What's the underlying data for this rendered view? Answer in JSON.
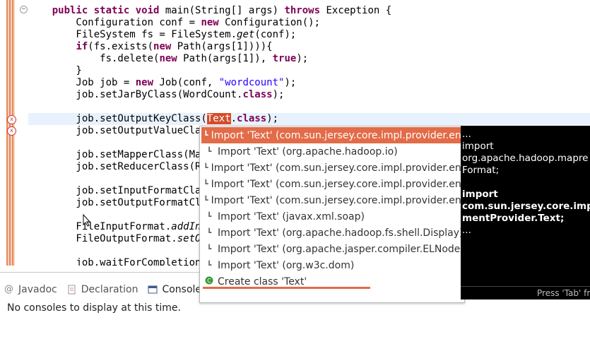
{
  "editor": {
    "lines": [
      {
        "segments": [
          {
            "t": "    ",
            "c": ""
          },
          {
            "t": "public static void",
            "c": "kw"
          },
          {
            "t": " main(String[] args) ",
            "c": ""
          },
          {
            "t": "throws",
            "c": "kw"
          },
          {
            "t": " Exception {",
            "c": ""
          }
        ]
      },
      {
        "segments": [
          {
            "t": "        Configuration conf = ",
            "c": ""
          },
          {
            "t": "new",
            "c": "kw"
          },
          {
            "t": " Configuration();",
            "c": ""
          }
        ]
      },
      {
        "segments": [
          {
            "t": "        FileSystem fs = FileSystem.",
            "c": ""
          },
          {
            "t": "get",
            "c": "it"
          },
          {
            "t": "(conf);",
            "c": ""
          }
        ]
      },
      {
        "segments": [
          {
            "t": "        ",
            "c": ""
          },
          {
            "t": "if",
            "c": "kw"
          },
          {
            "t": "(fs.exists(",
            "c": ""
          },
          {
            "t": "new",
            "c": "kw"
          },
          {
            "t": " Path(args[1]))){",
            "c": ""
          }
        ]
      },
      {
        "segments": [
          {
            "t": "            fs.delete(",
            "c": ""
          },
          {
            "t": "new",
            "c": "kw"
          },
          {
            "t": " Path(args[1]), ",
            "c": ""
          },
          {
            "t": "true",
            "c": "kw"
          },
          {
            "t": ");",
            "c": ""
          }
        ]
      },
      {
        "segments": [
          {
            "t": "        }",
            "c": ""
          }
        ]
      },
      {
        "segments": [
          {
            "t": "        Job job = ",
            "c": ""
          },
          {
            "t": "new",
            "c": "kw"
          },
          {
            "t": " Job(conf, ",
            "c": ""
          },
          {
            "t": "\"wordcount\"",
            "c": "str"
          },
          {
            "t": ");",
            "c": ""
          }
        ]
      },
      {
        "segments": [
          {
            "t": "        job.setJarByClass(WordCount.",
            "c": ""
          },
          {
            "t": "class",
            "c": "kw"
          },
          {
            "t": ");",
            "c": ""
          }
        ]
      },
      {
        "segments": []
      },
      {
        "segments": [
          {
            "t": "        job.setOutputKeyClass(",
            "c": ""
          },
          {
            "t": "Text",
            "c": "hl"
          },
          {
            "t": ".",
            "c": ""
          },
          {
            "t": "class",
            "c": "kw"
          },
          {
            "t": ");",
            "c": ""
          }
        ]
      },
      {
        "segments": [
          {
            "t": "        job.setOutputValueClas",
            "c": ""
          }
        ]
      },
      {
        "segments": []
      },
      {
        "segments": [
          {
            "t": "        job.setMapperClass(Map",
            "c": ""
          }
        ]
      },
      {
        "segments": [
          {
            "t": "        job.setReducerClass(Re",
            "c": ""
          }
        ]
      },
      {
        "segments": []
      },
      {
        "segments": [
          {
            "t": "        job.setInputFormatClas",
            "c": ""
          }
        ]
      },
      {
        "segments": [
          {
            "t": "        job.setOutputFormatCla",
            "c": ""
          }
        ]
      },
      {
        "segments": []
      },
      {
        "segments": [
          {
            "t": "        FileInputFormat.",
            "c": ""
          },
          {
            "t": "addInp",
            "c": "it"
          }
        ]
      },
      {
        "segments": [
          {
            "t": "        FileOutputFormat.",
            "c": ""
          },
          {
            "t": "setOu",
            "c": "it"
          }
        ]
      },
      {
        "segments": []
      },
      {
        "segments": [
          {
            "t": "        job.waitForCompletion(",
            "c": ""
          }
        ]
      }
    ]
  },
  "bottom_panel": {
    "tabs": [
      {
        "label": "Javadoc",
        "icon": "at-icon"
      },
      {
        "label": "Declaration",
        "icon": "declaration-icon"
      },
      {
        "label": "Console",
        "icon": "console-icon"
      }
    ],
    "message": "No consoles to display at this time."
  },
  "autocomplete": {
    "items": [
      {
        "label": "Import 'Text' (com.sun.jersey.core.impl.provider.ent",
        "icon": "import-icon",
        "selected": true
      },
      {
        "label": "Import 'Text' (org.apache.hadoop.io)",
        "icon": "import-icon",
        "selected": false
      },
      {
        "label": "Import 'Text' (com.sun.jersey.core.impl.provider.ent",
        "icon": "import-icon",
        "selected": false
      },
      {
        "label": "Import 'Text' (com.sun.jersey.core.impl.provider.ent",
        "icon": "import-icon",
        "selected": false
      },
      {
        "label": "Import 'Text' (com.sun.jersey.core.impl.provider.ent",
        "icon": "import-icon",
        "selected": false
      },
      {
        "label": "Import 'Text' (javax.xml.soap)",
        "icon": "import-icon",
        "selected": false
      },
      {
        "label": "Import 'Text' (org.apache.hadoop.fs.shell.Display)",
        "icon": "import-icon",
        "selected": false
      },
      {
        "label": "Import 'Text' (org.apache.jasper.compiler.ELNode)",
        "icon": "import-icon",
        "selected": false
      },
      {
        "label": "Import 'Text' (org.w3c.dom)",
        "icon": "import-icon",
        "selected": false
      },
      {
        "label": "Create class 'Text'",
        "icon": "create-class-icon",
        "selected": false
      }
    ]
  },
  "tooltip": {
    "lines": [
      {
        "text": "...",
        "bold": false
      },
      {
        "text": "import",
        "bold": false
      },
      {
        "text": "org.apache.hadoop.mapre",
        "bold": false
      },
      {
        "text": "Format;",
        "bold": false
      },
      {
        "text": "",
        "bold": false
      },
      {
        "text": "import",
        "bold": true
      },
      {
        "text": "com.sun.jersey.core.impl.",
        "bold": true
      },
      {
        "text": "mentProvider.Text;",
        "bold": true
      },
      {
        "text": "...",
        "bold": false
      }
    ],
    "footer": "Press 'Tab' fro"
  },
  "colors": {
    "selection": "#e26b48",
    "keyword": "#7f0055",
    "string": "#2a00ff"
  }
}
